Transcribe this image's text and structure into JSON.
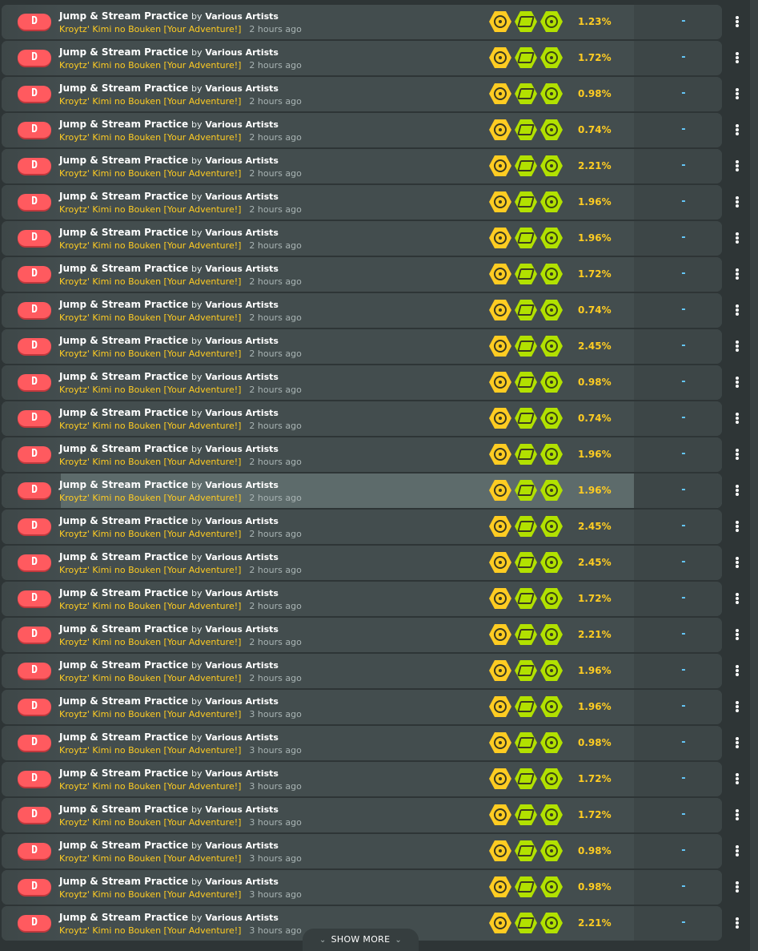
{
  "score_list": {
    "rows": [
      {
        "grade": "D",
        "title": "Jump & Stream Practice",
        "by": "by",
        "artist": "Various Artists",
        "difficulty": "Kroytz' Kimi no Bouken [Your Adventure!]",
        "time_ago": "2 hours ago",
        "accuracy": "1.23%",
        "pp": "-"
      },
      {
        "grade": "D",
        "title": "Jump & Stream Practice",
        "by": "by",
        "artist": "Various Artists",
        "difficulty": "Kroytz' Kimi no Bouken [Your Adventure!]",
        "time_ago": "2 hours ago",
        "accuracy": "1.72%",
        "pp": "-"
      },
      {
        "grade": "D",
        "title": "Jump & Stream Practice",
        "by": "by",
        "artist": "Various Artists",
        "difficulty": "Kroytz' Kimi no Bouken [Your Adventure!]",
        "time_ago": "2 hours ago",
        "accuracy": "0.98%",
        "pp": "-"
      },
      {
        "grade": "D",
        "title": "Jump & Stream Practice",
        "by": "by",
        "artist": "Various Artists",
        "difficulty": "Kroytz' Kimi no Bouken [Your Adventure!]",
        "time_ago": "2 hours ago",
        "accuracy": "0.74%",
        "pp": "-"
      },
      {
        "grade": "D",
        "title": "Jump & Stream Practice",
        "by": "by",
        "artist": "Various Artists",
        "difficulty": "Kroytz' Kimi no Bouken [Your Adventure!]",
        "time_ago": "2 hours ago",
        "accuracy": "2.21%",
        "pp": "-"
      },
      {
        "grade": "D",
        "title": "Jump & Stream Practice",
        "by": "by",
        "artist": "Various Artists",
        "difficulty": "Kroytz' Kimi no Bouken [Your Adventure!]",
        "time_ago": "2 hours ago",
        "accuracy": "1.96%",
        "pp": "-"
      },
      {
        "grade": "D",
        "title": "Jump & Stream Practice",
        "by": "by",
        "artist": "Various Artists",
        "difficulty": "Kroytz' Kimi no Bouken [Your Adventure!]",
        "time_ago": "2 hours ago",
        "accuracy": "1.96%",
        "pp": "-"
      },
      {
        "grade": "D",
        "title": "Jump & Stream Practice",
        "by": "by",
        "artist": "Various Artists",
        "difficulty": "Kroytz' Kimi no Bouken [Your Adventure!]",
        "time_ago": "2 hours ago",
        "accuracy": "1.72%",
        "pp": "-"
      },
      {
        "grade": "D",
        "title": "Jump & Stream Practice",
        "by": "by",
        "artist": "Various Artists",
        "difficulty": "Kroytz' Kimi no Bouken [Your Adventure!]",
        "time_ago": "2 hours ago",
        "accuracy": "0.74%",
        "pp": "-"
      },
      {
        "grade": "D",
        "title": "Jump & Stream Practice",
        "by": "by",
        "artist": "Various Artists",
        "difficulty": "Kroytz' Kimi no Bouken [Your Adventure!]",
        "time_ago": "2 hours ago",
        "accuracy": "2.45%",
        "pp": "-"
      },
      {
        "grade": "D",
        "title": "Jump & Stream Practice",
        "by": "by",
        "artist": "Various Artists",
        "difficulty": "Kroytz' Kimi no Bouken [Your Adventure!]",
        "time_ago": "2 hours ago",
        "accuracy": "0.98%",
        "pp": "-"
      },
      {
        "grade": "D",
        "title": "Jump & Stream Practice",
        "by": "by",
        "artist": "Various Artists",
        "difficulty": "Kroytz' Kimi no Bouken [Your Adventure!]",
        "time_ago": "2 hours ago",
        "accuracy": "0.74%",
        "pp": "-"
      },
      {
        "grade": "D",
        "title": "Jump & Stream Practice",
        "by": "by",
        "artist": "Various Artists",
        "difficulty": "Kroytz' Kimi no Bouken [Your Adventure!]",
        "time_ago": "2 hours ago",
        "accuracy": "1.96%",
        "pp": "-"
      },
      {
        "grade": "D",
        "title": "Jump & Stream Practice",
        "by": "by",
        "artist": "Various Artists",
        "difficulty": "Kroytz' Kimi no Bouken [Your Adventure!]",
        "time_ago": "2 hours ago",
        "accuracy": "1.96%",
        "pp": "-",
        "highlighted": true
      },
      {
        "grade": "D",
        "title": "Jump & Stream Practice",
        "by": "by",
        "artist": "Various Artists",
        "difficulty": "Kroytz' Kimi no Bouken [Your Adventure!]",
        "time_ago": "2 hours ago",
        "accuracy": "2.45%",
        "pp": "-"
      },
      {
        "grade": "D",
        "title": "Jump & Stream Practice",
        "by": "by",
        "artist": "Various Artists",
        "difficulty": "Kroytz' Kimi no Bouken [Your Adventure!]",
        "time_ago": "2 hours ago",
        "accuracy": "2.45%",
        "pp": "-"
      },
      {
        "grade": "D",
        "title": "Jump & Stream Practice",
        "by": "by",
        "artist": "Various Artists",
        "difficulty": "Kroytz' Kimi no Bouken [Your Adventure!]",
        "time_ago": "2 hours ago",
        "accuracy": "1.72%",
        "pp": "-"
      },
      {
        "grade": "D",
        "title": "Jump & Stream Practice",
        "by": "by",
        "artist": "Various Artists",
        "difficulty": "Kroytz' Kimi no Bouken [Your Adventure!]",
        "time_ago": "2 hours ago",
        "accuracy": "2.21%",
        "pp": "-"
      },
      {
        "grade": "D",
        "title": "Jump & Stream Practice",
        "by": "by",
        "artist": "Various Artists",
        "difficulty": "Kroytz' Kimi no Bouken [Your Adventure!]",
        "time_ago": "2 hours ago",
        "accuracy": "1.96%",
        "pp": "-"
      },
      {
        "grade": "D",
        "title": "Jump & Stream Practice",
        "by": "by",
        "artist": "Various Artists",
        "difficulty": "Kroytz' Kimi no Bouken [Your Adventure!]",
        "time_ago": "3 hours ago",
        "accuracy": "1.96%",
        "pp": "-"
      },
      {
        "grade": "D",
        "title": "Jump & Stream Practice",
        "by": "by",
        "artist": "Various Artists",
        "difficulty": "Kroytz' Kimi no Bouken [Your Adventure!]",
        "time_ago": "3 hours ago",
        "accuracy": "0.98%",
        "pp": "-"
      },
      {
        "grade": "D",
        "title": "Jump & Stream Practice",
        "by": "by",
        "artist": "Various Artists",
        "difficulty": "Kroytz' Kimi no Bouken [Your Adventure!]",
        "time_ago": "3 hours ago",
        "accuracy": "1.72%",
        "pp": "-"
      },
      {
        "grade": "D",
        "title": "Jump & Stream Practice",
        "by": "by",
        "artist": "Various Artists",
        "difficulty": "Kroytz' Kimi no Bouken [Your Adventure!]",
        "time_ago": "3 hours ago",
        "accuracy": "1.72%",
        "pp": "-"
      },
      {
        "grade": "D",
        "title": "Jump & Stream Practice",
        "by": "by",
        "artist": "Various Artists",
        "difficulty": "Kroytz' Kimi no Bouken [Your Adventure!]",
        "time_ago": "3 hours ago",
        "accuracy": "0.98%",
        "pp": "-"
      },
      {
        "grade": "D",
        "title": "Jump & Stream Practice",
        "by": "by",
        "artist": "Various Artists",
        "difficulty": "Kroytz' Kimi no Bouken [Your Adventure!]",
        "time_ago": "3 hours ago",
        "accuracy": "0.98%",
        "pp": "-"
      },
      {
        "grade": "D",
        "title": "Jump & Stream Practice",
        "by": "by",
        "artist": "Various Artists",
        "difficulty": "Kroytz' Kimi no Bouken [Your Adventure!]",
        "time_ago": "3 hours ago",
        "accuracy": "2.21%",
        "pp": "-"
      }
    ],
    "mods": [
      "hidden-mod-icon",
      "no-fail-mod-icon",
      "spun-out-mod-icon"
    ]
  },
  "show_more": {
    "label": "SHOW MORE"
  },
  "colors": {
    "grade_d": "#ff5a5f",
    "accuracy": "#ffcc22",
    "difficulty": "#ffcc22",
    "pp": "#66ccff",
    "mod_hidden": "#ffcc22",
    "mod_green": "#b2e100"
  }
}
